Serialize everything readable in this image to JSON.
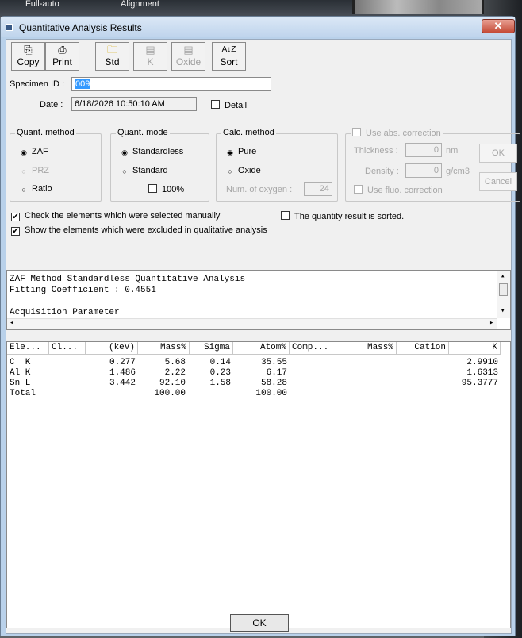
{
  "background": {
    "tabs": [
      "Full-auto",
      "Alignment"
    ]
  },
  "window": {
    "title": "Quantitative Analysis Results",
    "close_glyph": "✕"
  },
  "toolbar": [
    {
      "label": "Copy",
      "icon": "copy-icon",
      "glyph": "⎘",
      "enabled": true
    },
    {
      "label": "Print",
      "icon": "printer-icon",
      "glyph": "⎙",
      "enabled": true
    },
    {
      "label": "Std",
      "icon": "folder-icon",
      "glyph": "🗀",
      "enabled": true
    },
    {
      "label": "K",
      "icon": "document-icon",
      "glyph": "▤",
      "enabled": false
    },
    {
      "label": "Oxide",
      "icon": "document-icon",
      "glyph": "▤",
      "enabled": false
    },
    {
      "label": "Sort",
      "icon": "sort-az-icon",
      "glyph": "A↓Z",
      "enabled": true
    }
  ],
  "specimen": {
    "label": "Specimen ID :",
    "value": "009"
  },
  "date": {
    "label": "Date :",
    "value": "6/18/2026 10:50:10 AM"
  },
  "detail": {
    "label": "Detail",
    "checked": false
  },
  "quant_method": {
    "title": "Quant. method",
    "options": [
      "ZAF",
      "PRZ",
      "Ratio"
    ],
    "selected": "ZAF"
  },
  "quant_mode": {
    "title": "Quant. mode",
    "options": [
      "Standardless",
      "Standard"
    ],
    "selected": "Standardless",
    "percent_label": "100%"
  },
  "calc_method": {
    "title": "Calc. method",
    "options": [
      "Pure",
      "Oxide"
    ],
    "selected": "Pure",
    "oxygen_label": "Num. of oxygen :",
    "oxygen_value": "24"
  },
  "abs_correction": {
    "title": "Use abs. correction",
    "thickness_label": "Thickness :",
    "thickness_value": "0",
    "thickness_unit": "nm",
    "density_label": "Density :",
    "density_value": "0",
    "density_unit": "g/cm3",
    "fluo_label": "Use fluo. correction",
    "ok_label": "OK",
    "cancel_label": "Cancel"
  },
  "options": {
    "check_manual": {
      "label": "Check the elements which were selected manually",
      "checked": true
    },
    "show_excluded": {
      "label": "Show the elements which were excluded in qualitative analysis",
      "checked": true
    },
    "sorted": {
      "label": "The quantity result is sorted.",
      "checked": false
    }
  },
  "report_lines": [
    "ZAF Method Standardless Quantitative Analysis",
    "Fitting Coefficient : 0.4551",
    "",
    "Acquisition Parameter"
  ],
  "results": {
    "headers": [
      "Ele...",
      "Cl...",
      "(keV)",
      "Mass%",
      "Sigma",
      "Atom%",
      "Comp...",
      "Mass%",
      "Cation",
      "K"
    ],
    "rows": [
      [
        "C  K",
        "",
        "0.277",
        "5.68",
        "0.14",
        "35.55",
        "",
        "",
        "",
        "2.9910"
      ],
      [
        "Al K",
        "",
        "1.486",
        "2.22",
        "0.23",
        "6.17",
        "",
        "",
        "",
        "1.6313"
      ],
      [
        "Sn L",
        "",
        "3.442",
        "92.10",
        "1.58",
        "58.28",
        "",
        "",
        "",
        "95.3777"
      ],
      [
        "Total",
        "",
        "",
        "100.00",
        "",
        "100.00",
        "",
        "",
        "",
        ""
      ]
    ]
  },
  "ok_label": "OK",
  "check_glyph": "✔",
  "radio_on": "◉",
  "radio_off": "○",
  "scroll_up": "▴",
  "scroll_down": "▾",
  "scroll_left": "◂",
  "scroll_right": "▸"
}
